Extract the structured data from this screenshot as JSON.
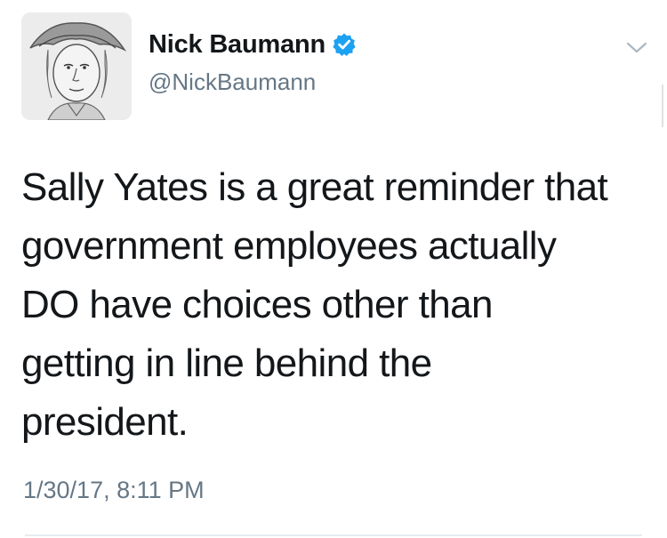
{
  "tweet": {
    "author": {
      "display_name": "Nick Baumann",
      "handle": "@NickBaumann",
      "verified": true,
      "avatar_icon": "profile-avatar"
    },
    "text": "Sally Yates is a great reminder that\ngovernment employees actually\nDO have choices other than\ngetting in line behind the\npresident.",
    "timestamp": "1/30/17, 8:11 PM",
    "menu_icon": "chevron-down-icon",
    "colors": {
      "verified_badge": "#1da1f2",
      "secondary_text": "#657786",
      "primary_text": "#14171a"
    }
  }
}
